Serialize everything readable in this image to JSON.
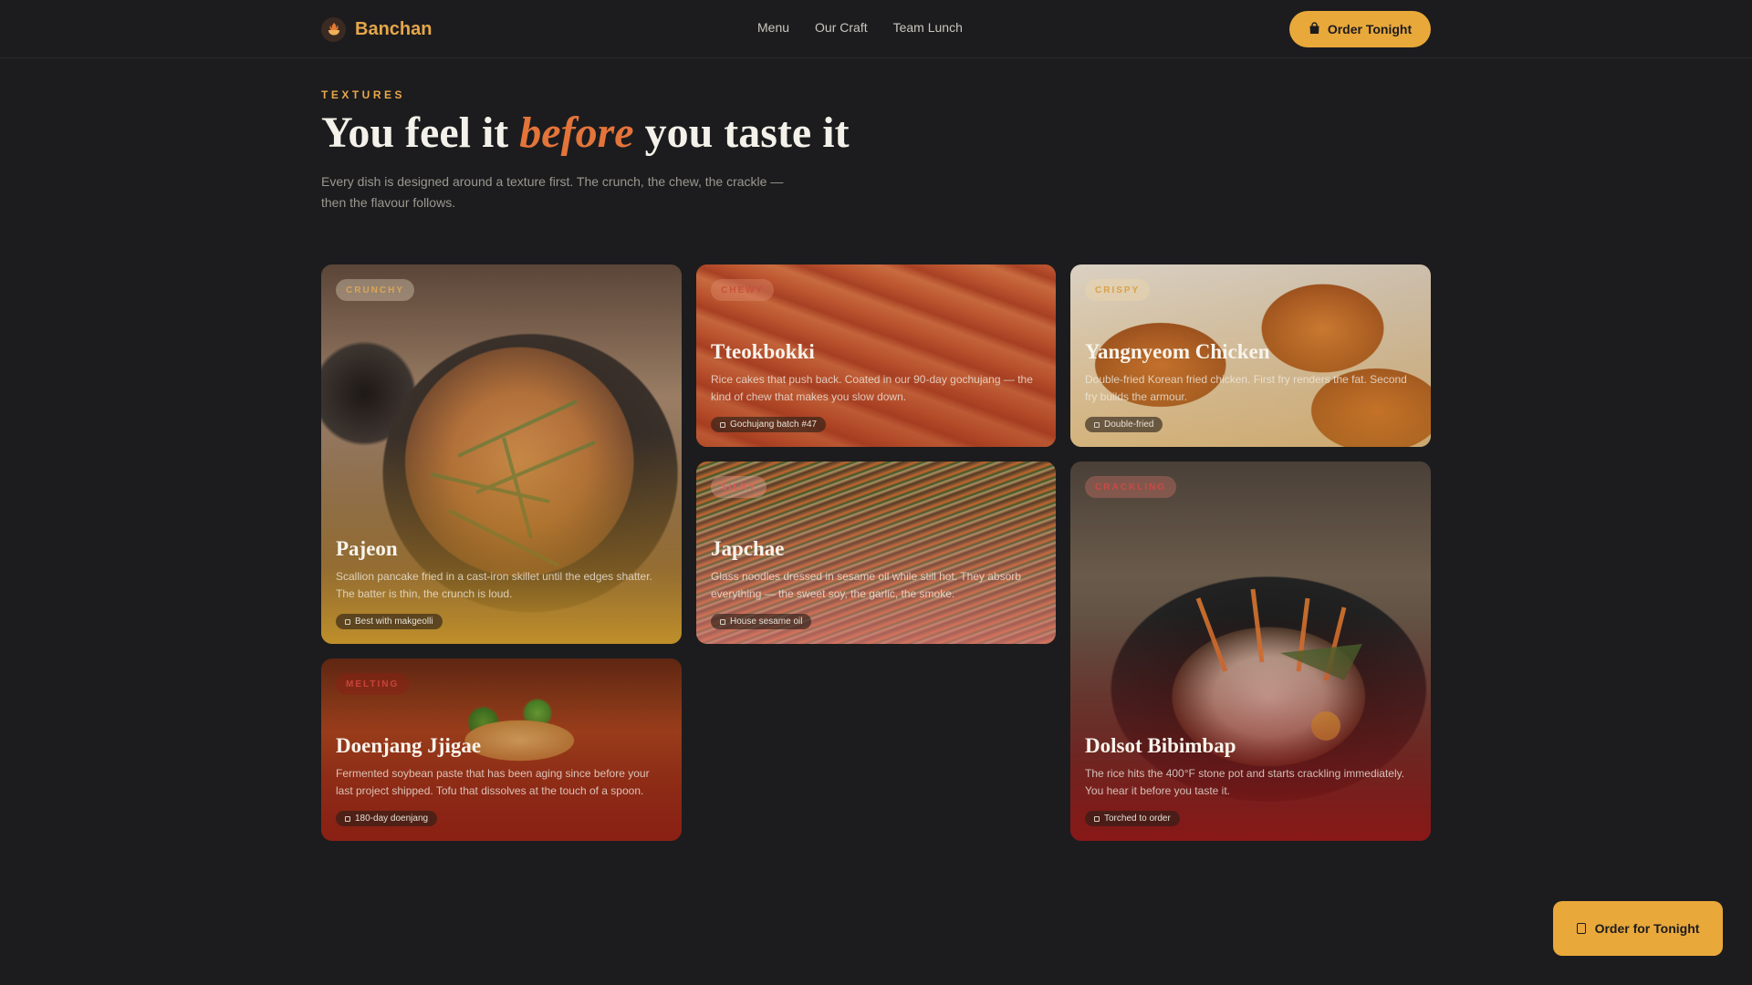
{
  "header": {
    "brand": "Banchan",
    "nav": [
      "Menu",
      "Our Craft",
      "Team Lunch"
    ],
    "order_button": "Order Tonight"
  },
  "hero": {
    "eyebrow": "TEXTURES",
    "title_pre": "You feel it ",
    "title_em": "before",
    "title_post": " you taste it",
    "subtitle": "Every dish is designed around a texture first. The crunch, the chew, the crackle — then the flavour follows."
  },
  "cards": [
    {
      "tag": "CRUNCHY",
      "name": "Pajeon",
      "desc": "Scallion pancake fried in a cast-iron skillet until the edges shatter. The batter is thin, the crunch is loud.",
      "pill": "Best with makgeolli",
      "tag_color": "#c9914a"
    },
    {
      "tag": "CHEWY",
      "name": "Tteokbokki",
      "desc": "Rice cakes that push back. Coated in our 90-day gochujang — the kind of chew that makes you slow down.",
      "pill": "Gochujang batch #47",
      "tag_color": "#d86a4a"
    },
    {
      "tag": "CRISPY",
      "name": "Yangnyeom Chicken",
      "desc": "Double-fried Korean fried chicken. First fry renders the fat. Second fry builds the armour.",
      "pill": "Double-fried",
      "tag_color": "#d9a14a"
    },
    {
      "tag": "SILKY",
      "name": "Japchae",
      "desc": "Glass noodles dressed in sesame oil while still hot. They absorb everything — the sweet soy, the garlic, the smoke.",
      "pill": "House sesame oil",
      "tag_color": "#d9605a"
    },
    {
      "tag": "CRACKLING",
      "name": "Dolsot Bibimbap",
      "desc": "The rice hits the 400°F stone pot and starts crackling immediately. You hear it before you taste it.",
      "pill": "Torched to order",
      "tag_color": "#c94a44"
    },
    {
      "tag": "MELTING",
      "name": "Doenjang Jjigae",
      "desc": "Fermented soybean paste that has been aging since before your last project shipped. Tofu that dissolves at the touch of a spoon.",
      "pill": "180-day doenjang",
      "tag_color": "#c9443a"
    }
  ],
  "float_button": "Order for Tonight",
  "colors": {
    "accent": "#e9a83a",
    "background": "#1c1c1e",
    "italic": "#e3743a"
  }
}
